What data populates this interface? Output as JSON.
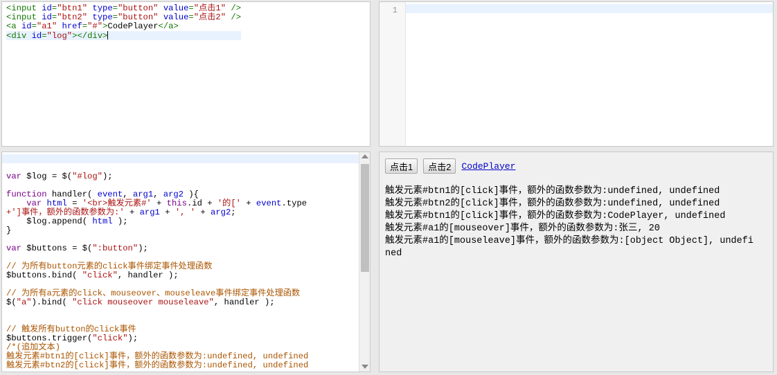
{
  "html_editor": {
    "lines": [
      {
        "parts": [
          [
            "tag",
            "<input "
          ],
          [
            "attr",
            "id"
          ],
          [
            "tag",
            "="
          ],
          [
            "str",
            "\"btn1\""
          ],
          [
            "tag",
            " "
          ],
          [
            "attr",
            "type"
          ],
          [
            "tag",
            "="
          ],
          [
            "str",
            "\"button\""
          ],
          [
            "tag",
            " "
          ],
          [
            "attr",
            "value"
          ],
          [
            "tag",
            "="
          ],
          [
            "str",
            "\"点击1\""
          ],
          [
            "tag",
            " />"
          ]
        ]
      },
      {
        "parts": [
          [
            "tag",
            "<input "
          ],
          [
            "attr",
            "id"
          ],
          [
            "tag",
            "="
          ],
          [
            "str",
            "\"btn2\""
          ],
          [
            "tag",
            " "
          ],
          [
            "attr",
            "type"
          ],
          [
            "tag",
            "="
          ],
          [
            "str",
            "\"button\""
          ],
          [
            "tag",
            " "
          ],
          [
            "attr",
            "value"
          ],
          [
            "tag",
            "="
          ],
          [
            "str",
            "\"点击2\""
          ],
          [
            "tag",
            " />"
          ]
        ]
      },
      {
        "parts": [
          [
            "tag",
            "<a "
          ],
          [
            "attr",
            "id"
          ],
          [
            "tag",
            "="
          ],
          [
            "str",
            "\"a1\""
          ],
          [
            "tag",
            " "
          ],
          [
            "attr",
            "href"
          ],
          [
            "tag",
            "="
          ],
          [
            "str",
            "\"#\""
          ],
          [
            "tag",
            ">"
          ],
          [
            "prop",
            "CodePlayer"
          ],
          [
            "tag",
            "</a>"
          ]
        ]
      },
      {
        "parts": [
          [
            "tag",
            "<div "
          ],
          [
            "attr",
            "id"
          ],
          [
            "tag",
            "="
          ],
          [
            "str",
            "\"log\""
          ],
          [
            "tag",
            "></div>"
          ]
        ],
        "active": true,
        "cursor": true
      }
    ]
  },
  "css_editor": {
    "line_number": "1"
  },
  "js_editor": {
    "lines": [
      {
        "parts": [
          [
            "kw",
            "var"
          ],
          [
            "prop",
            " $log = $("
          ],
          [
            "str",
            "\"#log\""
          ],
          [
            "prop",
            ");"
          ]
        ]
      },
      {
        "parts": []
      },
      {
        "parts": [
          [
            "kw",
            "function"
          ],
          [
            "prop",
            " handler( "
          ],
          [
            "var",
            "event"
          ],
          [
            "prop",
            ", "
          ],
          [
            "var",
            "arg1"
          ],
          [
            "prop",
            ", "
          ],
          [
            "var",
            "arg2"
          ],
          [
            "prop",
            " ){"
          ]
        ]
      },
      {
        "parts": [
          [
            "prop",
            "    "
          ],
          [
            "kw",
            "var"
          ],
          [
            "prop",
            " "
          ],
          [
            "var",
            "html"
          ],
          [
            "prop",
            " = "
          ],
          [
            "str",
            "'<br>触发元素#'"
          ],
          [
            "prop",
            " + "
          ],
          [
            "kw",
            "this"
          ],
          [
            "prop",
            ".id + "
          ],
          [
            "str",
            "'的['"
          ],
          [
            "prop",
            " + "
          ],
          [
            "var",
            "event"
          ],
          [
            "prop",
            ".type"
          ]
        ]
      },
      {
        "parts": [
          [
            "str",
            "+']事件，额外的函数参数为:'"
          ],
          [
            "prop",
            " + "
          ],
          [
            "var",
            "arg1"
          ],
          [
            "prop",
            " + "
          ],
          [
            "str",
            "', '"
          ],
          [
            "prop",
            " + "
          ],
          [
            "var",
            "arg2"
          ],
          [
            "prop",
            ";"
          ]
        ]
      },
      {
        "parts": [
          [
            "prop",
            "    $log.append( "
          ],
          [
            "var",
            "html"
          ],
          [
            "prop",
            " );"
          ]
        ]
      },
      {
        "parts": [
          [
            "prop",
            "}"
          ]
        ]
      },
      {
        "parts": []
      },
      {
        "parts": [
          [
            "kw",
            "var"
          ],
          [
            "prop",
            " $buttons = $("
          ],
          [
            "str",
            "\":button\""
          ],
          [
            "prop",
            ");"
          ]
        ]
      },
      {
        "parts": []
      },
      {
        "parts": [
          [
            "cmt",
            "// 为所有button元素的click事件绑定事件处理函数"
          ]
        ]
      },
      {
        "parts": [
          [
            "prop",
            "$buttons.bind( "
          ],
          [
            "str",
            "\"click\""
          ],
          [
            "prop",
            ", handler );"
          ]
        ]
      },
      {
        "parts": []
      },
      {
        "parts": [
          [
            "cmt",
            "// 为所有a元素的click、mouseover、mouseleave事件绑定事件处理函数"
          ]
        ]
      },
      {
        "parts": [
          [
            "prop",
            "$("
          ],
          [
            "str",
            "\"a\""
          ],
          [
            "prop",
            ").bind( "
          ],
          [
            "str",
            "\"click mouseover mouseleave\""
          ],
          [
            "prop",
            ", handler );"
          ]
        ]
      },
      {
        "parts": []
      },
      {
        "parts": []
      },
      {
        "parts": [
          [
            "cmt",
            "// 触发所有button的click事件"
          ]
        ]
      },
      {
        "parts": [
          [
            "prop",
            "$buttons.trigger("
          ],
          [
            "str",
            "\"click\""
          ],
          [
            "prop",
            ");"
          ]
        ]
      },
      {
        "parts": [
          [
            "cmt",
            "/*(追加文本)"
          ]
        ]
      },
      {
        "parts": [
          [
            "cmt",
            "触发元素#btn1的[click]事件，额外的函数参数为:undefined, undefined"
          ]
        ]
      },
      {
        "parts": [
          [
            "cmt",
            "触发元素#btn2的[click]事件，额外的函数参数为:undefined, undefined"
          ]
        ]
      }
    ]
  },
  "result": {
    "button1_label": "点击1",
    "button2_label": "点击2",
    "link_text": "CodePlayer",
    "log_lines": [
      "触发元素#btn1的[click]事件，额外的函数参数为:undefined, undefined",
      "触发元素#btn2的[click]事件，额外的函数参数为:undefined, undefined",
      "触发元素#btn1的[click]事件，额外的函数参数为:CodePlayer, undefined",
      "触发元素#a1的[mouseover]事件，额外的函数参数为:张三, 20",
      "触发元素#a1的[mouseleave]事件，额外的函数参数为:[object Object], undefined"
    ]
  },
  "colors": {
    "tag": "#117700",
    "attribute": "#0000cc",
    "string": "#aa1111",
    "keyword": "#770088",
    "comment": "#aa5500",
    "active_line": "#e8f2ff",
    "link": "#0000cc"
  }
}
